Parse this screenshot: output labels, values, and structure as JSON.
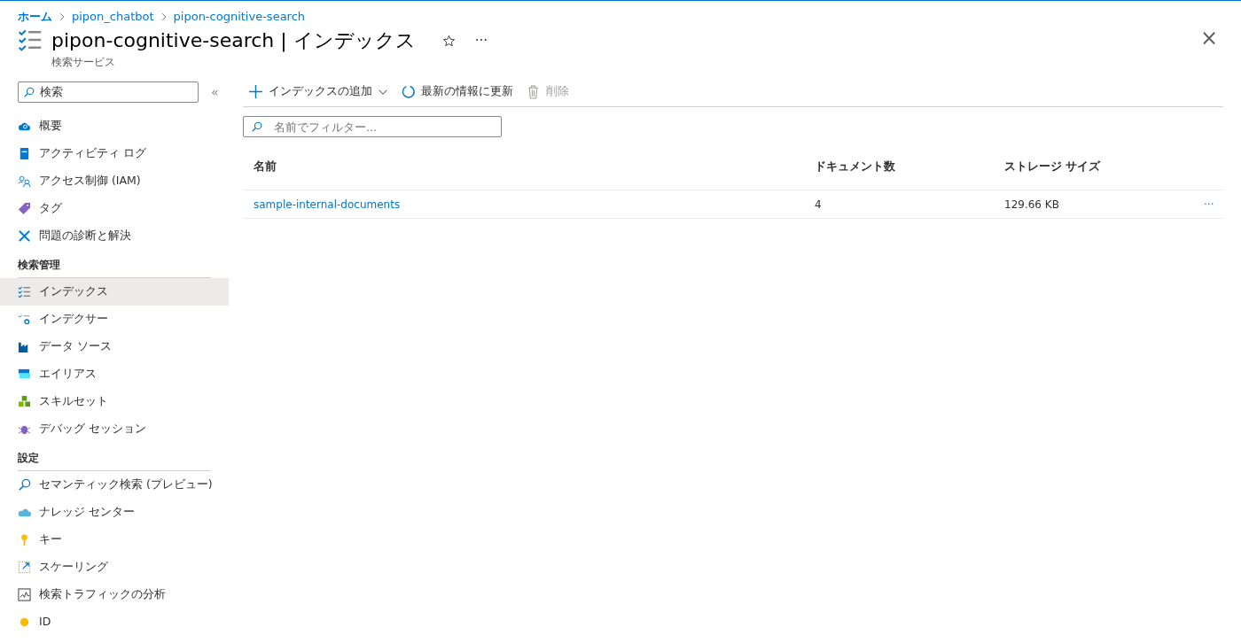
{
  "breadcrumb": [
    "ホーム",
    "pipon_chatbot",
    "pipon-cognitive-search"
  ],
  "header": {
    "title": "pipon-cognitive-search | インデックス",
    "subtitle": "検索サービス",
    "more": "···",
    "close": "×"
  },
  "sidebar": {
    "search": {
      "value": "検索"
    },
    "collapse": "«",
    "sections": [
      {
        "items": [
          {
            "label": "概要",
            "selected": false
          },
          {
            "label": "アクティビティ ログ",
            "selected": false
          },
          {
            "label": "アクセス制御 (IAM)",
            "selected": false
          },
          {
            "label": "タグ",
            "selected": false
          },
          {
            "label": "問題の診断と解決",
            "selected": false
          }
        ]
      },
      {
        "heading": "検索管理",
        "items": [
          {
            "label": "インデックス",
            "selected": true
          },
          {
            "label": "インデクサー",
            "selected": false
          },
          {
            "label": "データ ソース",
            "selected": false
          },
          {
            "label": "エイリアス",
            "selected": false
          },
          {
            "label": "スキルセット",
            "selected": false
          },
          {
            "label": "デバッグ セッション",
            "selected": false
          }
        ]
      },
      {
        "heading": "設定",
        "items": [
          {
            "label": "セマンティック検索 (プレビュー)",
            "selected": false
          },
          {
            "label": "ナレッジ センター",
            "selected": false
          },
          {
            "label": "キー",
            "selected": false
          },
          {
            "label": "スケーリング",
            "selected": false
          },
          {
            "label": "検索トラフィックの分析",
            "selected": false
          },
          {
            "label": "ID",
            "selected": false
          }
        ]
      }
    ]
  },
  "toolbar": [
    {
      "kind": "add",
      "label": "インデックスの追加",
      "disabled": false
    },
    {
      "kind": "refresh",
      "label": "最新の情報に更新",
      "disabled": false
    },
    {
      "kind": "delete",
      "label": "削除",
      "disabled": true
    }
  ],
  "filter": {
    "placeholder": "名前でフィルター..."
  },
  "table": {
    "columns": [
      "名前",
      "ドキュメント数",
      "ストレージ サイズ"
    ],
    "rows": [
      {
        "name": "sample-internal-documents",
        "documents": "4",
        "size": "129.66 KB",
        "more": "···"
      }
    ]
  }
}
